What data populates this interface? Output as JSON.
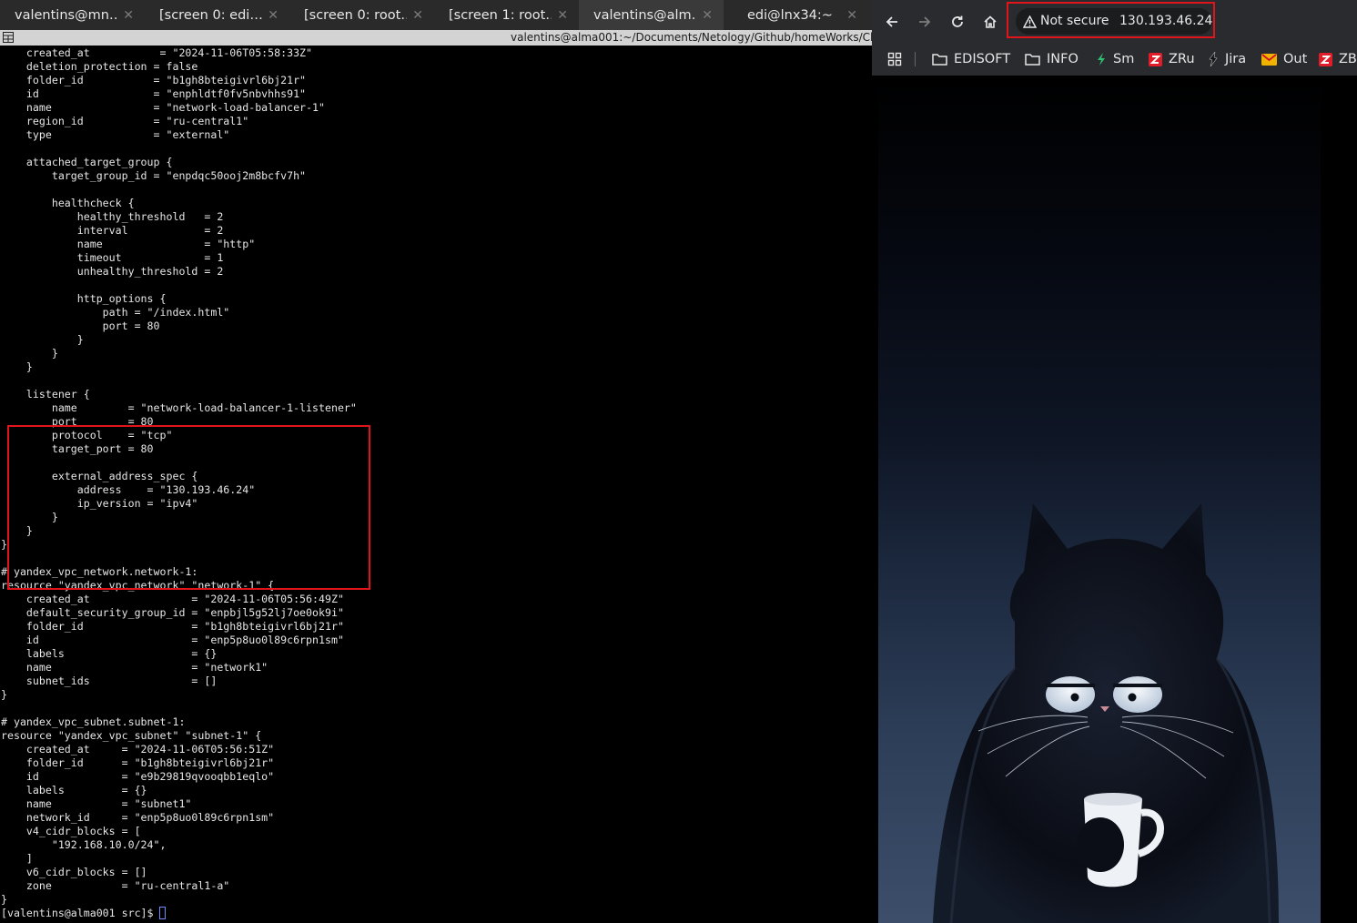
{
  "terminal": {
    "tabs": [
      {
        "label": "valentins@mn…"
      },
      {
        "label": "[screen 0: edi…"
      },
      {
        "label": "[screen 0: root…"
      },
      {
        "label": "[screen 1: root…"
      },
      {
        "label": "valentins@alm…"
      },
      {
        "label": "edi@lnx34:~"
      }
    ],
    "window_title": "valentins@alma001:~/Documents/Netology/Github/homeWorks/Cl",
    "lines": [
      "    created_at           = \"2024-11-06T05:58:33Z\"",
      "    deletion_protection = false",
      "    folder_id           = \"b1gh8bteigivrl6bj21r\"",
      "    id                  = \"enphldtf0fv5nbvhhs91\"",
      "    name                = \"network-load-balancer-1\"",
      "    region_id           = \"ru-central1\"",
      "    type                = \"external\"",
      "",
      "    attached_target_group {",
      "        target_group_id = \"enpdqc50ooj2m8bcfv7h\"",
      "",
      "        healthcheck {",
      "            healthy_threshold   = 2",
      "            interval            = 2",
      "            name                = \"http\"",
      "            timeout             = 1",
      "            unhealthy_threshold = 2",
      "",
      "            http_options {",
      "                path = \"/index.html\"",
      "                port = 80",
      "            }",
      "        }",
      "    }",
      "",
      "    listener {",
      "        name        = \"network-load-balancer-1-listener\"",
      "        port        = 80",
      "        protocol    = \"tcp\"",
      "        target_port = 80",
      "",
      "        external_address_spec {",
      "            address    = \"130.193.46.24\"",
      "            ip_version = \"ipv4\"",
      "        }",
      "    }",
      "}",
      "",
      "# yandex_vpc_network.network-1:",
      "resource \"yandex_vpc_network\" \"network-1\" {",
      "    created_at                = \"2024-11-06T05:56:49Z\"",
      "    default_security_group_id = \"enpbjl5g52lj7oe0ok9i\"",
      "    folder_id                 = \"b1gh8bteigivrl6bj21r\"",
      "    id                        = \"enp5p8uo0l89c6rpn1sm\"",
      "    labels                    = {}",
      "    name                      = \"network1\"",
      "    subnet_ids                = []",
      "}",
      "",
      "# yandex_vpc_subnet.subnet-1:",
      "resource \"yandex_vpc_subnet\" \"subnet-1\" {",
      "    created_at     = \"2024-11-06T05:56:51Z\"",
      "    folder_id      = \"b1gh8bteigivrl6bj21r\"",
      "    id             = \"e9b29819qvooqbb1eqlo\"",
      "    labels         = {}",
      "    name           = \"subnet1\"",
      "    network_id     = \"enp5p8uo0l89c6rpn1sm\"",
      "    v4_cidr_blocks = [",
      "        \"192.168.10.0/24\",",
      "    ]",
      "    v6_cidr_blocks = []",
      "    zone           = \"ru-central1-a\"",
      "}",
      "[valentins@alma001 src]$ "
    ]
  },
  "browser": {
    "security_label": "Not secure",
    "url": "130.193.46.24",
    "bookmarks": [
      {
        "label": "EDISOFT",
        "icon": "folder-icon"
      },
      {
        "label": "INFO",
        "icon": "folder-icon"
      },
      {
        "label": "Sm",
        "icon": "sm-favicon"
      },
      {
        "label": "ZRu",
        "icon": "z-favicon"
      },
      {
        "label": "Jira",
        "icon": "jira-favicon"
      },
      {
        "label": "Out",
        "icon": "mail-favicon"
      },
      {
        "label": "ZBU",
        "icon": "z-favicon"
      }
    ],
    "page_image": "black-cat-with-coffee-mug-image",
    "colors": {
      "highlight": "#e0141b",
      "z_red": "#e01e2a",
      "mail_yellow": "#f0b400"
    }
  }
}
